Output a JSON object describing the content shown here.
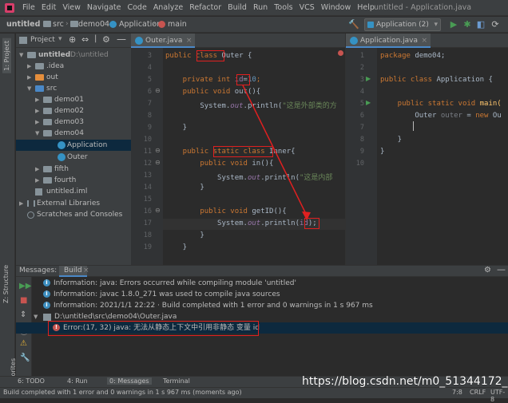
{
  "menubar": {
    "items": [
      "File",
      "Edit",
      "View",
      "Navigate",
      "Code",
      "Analyze",
      "Refactor",
      "Build",
      "Run",
      "Tools",
      "VCS",
      "Window",
      "Help"
    ],
    "window_title": "untitled - Application.java"
  },
  "navbar": {
    "crumbs": [
      "untitled",
      "src",
      "demo04",
      "Application",
      "main"
    ],
    "run_config": "Application (2)"
  },
  "left_stripe": {
    "project_tab": "1: Project",
    "structure_tab": "Z: Structure",
    "favorites_tab": "2: Favorites"
  },
  "project": {
    "header_label": "Project",
    "tree": [
      {
        "label": "untitled",
        "path": "D:\\untitled"
      },
      {
        "label": ".idea"
      },
      {
        "label": "out"
      },
      {
        "label": "src"
      },
      {
        "label": "demo01"
      },
      {
        "label": "demo02"
      },
      {
        "label": "demo03"
      },
      {
        "label": "demo04"
      },
      {
        "label": "Application"
      },
      {
        "label": "Outer"
      },
      {
        "label": "fifth"
      },
      {
        "label": "fourth"
      },
      {
        "label": "untitled.iml"
      },
      {
        "label": "External Libraries"
      },
      {
        "label": "Scratches and Consoles"
      }
    ]
  },
  "editor1": {
    "tab": "Outer.java",
    "line_numbers": [
      "3",
      "4",
      "5",
      "6",
      "7",
      "8",
      "9",
      "10",
      "11",
      "12",
      "13",
      "14",
      "15",
      "16",
      "17",
      "18",
      "19"
    ],
    "code": {
      "l3_a": "public ",
      "l3_b": "class",
      "l3_c": " Outer {",
      "l5_a": "    private int ",
      "l5_b": "id",
      "l5_c": "=",
      "l5_d": "10",
      "l5_e": ";",
      "l6_a": "    public void ",
      "l6_b": "out",
      "l6_c": "(){",
      "l7_a": "        System.",
      "l7_b": "out",
      "l7_c": ".println(",
      "l7_d": "\"这是外部类的方",
      "l9": "    }",
      "l11_a": "    public ",
      "l11_b": "static class",
      "l11_c": " Inner{",
      "l12_a": "        public void ",
      "l12_b": "in",
      "l12_c": "(){",
      "l13_a": "            System.",
      "l13_b": "out",
      "l13_c": ".println(",
      "l13_d": "\"这是内部",
      "l14": "        }",
      "l16_a": "        public void ",
      "l16_b": "getID",
      "l16_c": "(){",
      "l17_a": "            System.",
      "l17_b": "out",
      "l17_c": ".println(",
      "l17_d": "id",
      "l17_e": ");",
      "l18": "        }",
      "l19": "    }"
    }
  },
  "editor2": {
    "tab": "Application.java",
    "line_numbers": [
      "1",
      "2",
      "3",
      "4",
      "5",
      "6",
      "7",
      "8",
      "9",
      "10"
    ],
    "code": {
      "l1_a": "package ",
      "l1_b": "demo04;",
      "l3_a": "public class ",
      "l3_b": "Application {",
      "l5_a": "    public static void ",
      "l5_b": "main(",
      "l6_a": "        Outer ",
      "l6_b": "outer",
      "l6_c": " = ",
      "l6_d": "new ",
      "l6_e": "Ou",
      "l8": "    }",
      "l9": "}"
    }
  },
  "bottom": {
    "tabs": [
      "Messages:",
      "Build"
    ],
    "messages": [
      "Information: java: Errors occurred while compiling module 'untitled'",
      "Information: javac 1.8.0_271 was used to compile java sources",
      "Information: 2021/1/1 22:22 · Build completed with 1 error and 0 warnings in 1 s 967 ms"
    ],
    "file_path": "D:\\untitled\\src\\demo04\\Outer.java",
    "error": "Error:(17, 32)  java: 无法从静态上下文中引用非静态 变量 id"
  },
  "toolwin": [
    "6: TODO",
    "4: Run",
    "0: Messages",
    "Terminal"
  ],
  "status": {
    "text": "Build completed with 1 error and 0 warnings in 1 s 967 ms (moments ago)",
    "position": "7:8",
    "line_sep": "CRLF",
    "encoding": "UTF-8"
  },
  "watermark": "https://blog.csdn.net/m0_51344172_",
  "colors": {
    "keyword": "#cc7832",
    "field": "#9876aa",
    "string": "#6a8759",
    "number": "#6897bb",
    "annotation": "#e02020"
  }
}
